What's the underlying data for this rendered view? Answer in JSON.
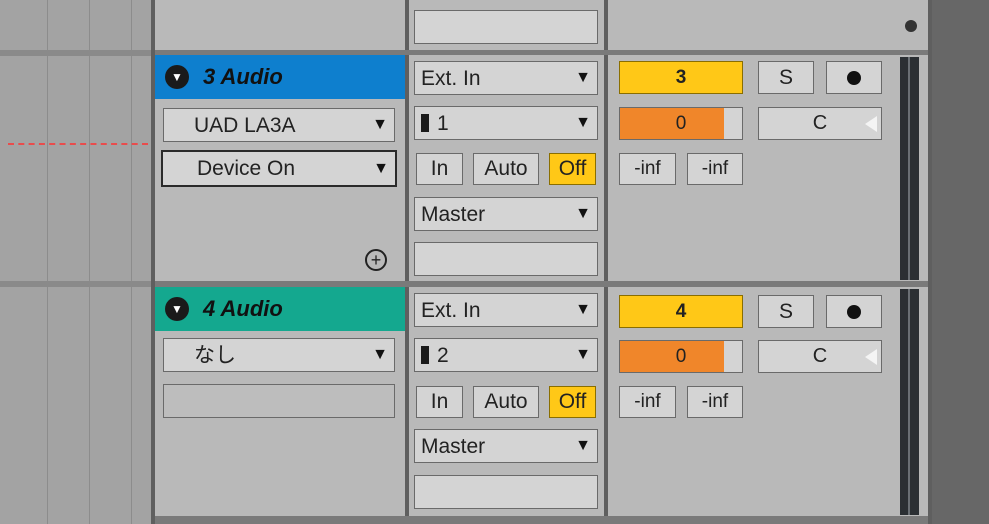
{
  "tracks": [
    {
      "name": "3 Audio",
      "header_color": "#0e7fce",
      "device": "UAD LA3A",
      "parameter": "Device On",
      "audio_from": "Ext. In",
      "channel": "1",
      "monitor": [
        "In",
        "Auto",
        "Off"
      ],
      "monitor_active": "Off",
      "audio_to": "Master",
      "number": "3",
      "volume_value": "0",
      "volume_fill": 0.85,
      "pan": "C",
      "solo": "S",
      "peak_left": "-inf",
      "peak_right": "-inf"
    },
    {
      "name": "4 Audio",
      "header_color": "#14a88f",
      "device": "なし",
      "parameter": "",
      "audio_from": "Ext. In",
      "channel": "2",
      "monitor": [
        "In",
        "Auto",
        "Off"
      ],
      "monitor_active": "Off",
      "audio_to": "Master",
      "number": "4",
      "volume_value": "0",
      "volume_fill": 0.85,
      "pan": "C",
      "solo": "S",
      "peak_left": "-inf",
      "peak_right": "-inf"
    }
  ],
  "icons": {
    "fold": "fold-triangle-icon",
    "arrow": "dropdown-arrow-icon",
    "add": "plus-circle-icon",
    "record": "record-arm-icon",
    "pan_indicator": "pan-triangle-icon"
  },
  "glyphs": {
    "arrow": "▼",
    "fold": "▼",
    "add": "+"
  }
}
